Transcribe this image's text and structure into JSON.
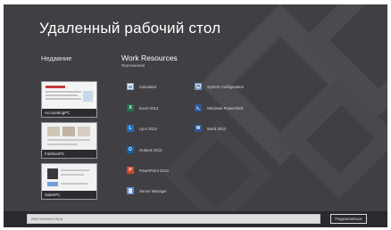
{
  "window": {
    "title": "Удаленный рабочий стол"
  },
  "recent": {
    "heading": "Недавние",
    "items": [
      {
        "label": "AccountingPC"
      },
      {
        "label": "FashionPC"
      },
      {
        "label": "SalesPC"
      }
    ]
  },
  "group": {
    "title": "Work Resources",
    "subtitle": "Приложения",
    "apps": [
      {
        "label": "Calculator",
        "icon": "calculator-icon",
        "color": "#7f9fc7",
        "glyph": ""
      },
      {
        "label": "Excel 2013",
        "icon": "excel-icon",
        "color": "#1e7145",
        "glyph": "X"
      },
      {
        "label": "Lync 2013",
        "icon": "lync-icon",
        "color": "#1f6dc1",
        "glyph": "L"
      },
      {
        "label": "Outlook 2013",
        "icon": "outlook-icon",
        "color": "#0a64ad",
        "glyph": "O"
      },
      {
        "label": "PowerPoint 2013",
        "icon": "powerpoint-icon",
        "color": "#d24726",
        "glyph": "P"
      },
      {
        "label": "Server Manager",
        "icon": "server-manager-icon",
        "color": "#5c8fd0",
        "glyph": ""
      },
      {
        "label": "System Configuration",
        "icon": "system-configuration-icon",
        "color": "#6f8fbf",
        "glyph": ""
      },
      {
        "label": "Windows PowerShell",
        "icon": "powershell-icon",
        "color": "#2b5797",
        "glyph": ""
      },
      {
        "label": "Word 2013",
        "icon": "word-icon",
        "color": "#2b579a",
        "glyph": "W"
      }
    ]
  },
  "connection": {
    "placeholder": "Имя компьютера",
    "connect_label": "Подключиться"
  }
}
